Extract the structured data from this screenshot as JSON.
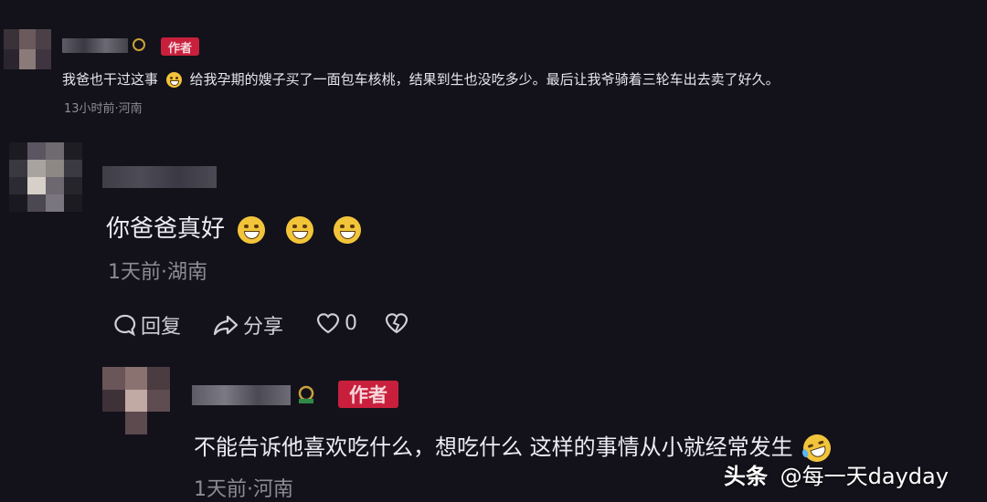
{
  "comments": [
    {
      "author_tag": "作者",
      "text": "我爸也干过这事",
      "text_rest": "给我孕期的嫂子买了一面包车核桃，结果到生也没吃多少。最后让我爷骑着三轮车出去卖了好久。",
      "meta": "13小时前·河南"
    },
    {
      "text": "你爸爸真好",
      "meta": "1天前·湖南",
      "actions": {
        "reply": "回复",
        "share": "分享",
        "like_count": "0"
      }
    },
    {
      "author_tag": "作者",
      "text": "不能告诉他喜欢吃什么，想吃什么 这样的事情从小就经常发生",
      "meta": "1天前·河南"
    }
  ],
  "watermark": {
    "platform": "头条",
    "account": "@每一天dayday"
  },
  "icons": [
    "reply-icon",
    "share-icon",
    "heart-icon",
    "dislike-heart-icon",
    "verified-badge-icon",
    "grin-emoji-icon",
    "laughing-emoji-icon"
  ]
}
